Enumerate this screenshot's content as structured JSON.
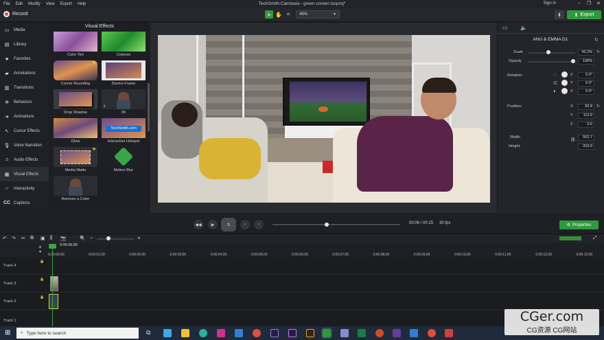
{
  "menu": [
    "File",
    "Edit",
    "Modify",
    "View",
    "Export",
    "Help"
  ],
  "app_title": "TechSmith Camtasia - green screen.tscproj*",
  "signin": "Sign in",
  "record_label": "Record",
  "zoom": "48%",
  "export_label": "Export",
  "sidebar": [
    "Media",
    "Library",
    "Favorites",
    "Annotations",
    "Transitions",
    "Behaviors",
    "Animations",
    "Cursor Effects",
    "Voice Narration",
    "Audio Effects",
    "Visual Effects",
    "Interactivity",
    "Captions"
  ],
  "effects_title": "Visual Effects",
  "effects": [
    "Color Tint",
    "Colorize",
    "Corner Rounding",
    "Device Frame",
    "Drop Shadow",
    "00",
    "Glow",
    "Interactive Hotspot",
    "Media Matte",
    "Motion Blur",
    "Remove a Color"
  ],
  "hotspot_text": "TechSmith.com",
  "props": {
    "clip_name": "ANU & EMMA D1",
    "scale_label": "Scale",
    "scale": "43.2%",
    "scale_fraction": 0.43,
    "opacity_label": "Opacity",
    "opacity": "100%",
    "opacity_fraction": 1.0,
    "rotation_label": "Rotation:",
    "rz": "0.0°",
    "ry": "0.0°",
    "rx": "0.0°",
    "position_label": "Position:",
    "px": "92.8",
    "py": "112.9",
    "pz": "0.0",
    "width_label": "Width:",
    "width": "552.7",
    "height_label": "Height:",
    "height": "310.9",
    "z": "Z",
    "y": "Y",
    "x": "X",
    "properties_btn": "Properties"
  },
  "timecode": "00:06 / 00:15",
  "fps": "30 fps",
  "playhead_time": "0:00:06;09",
  "ruler": [
    "0:00:00;00",
    "0:00:01;00",
    "0:00:02;00",
    "0:00:03;00",
    "0:00:04;00",
    "0:00:05;00",
    "0:00:06;00",
    "0:00:07;00",
    "0:00:08;00",
    "0:00:09;00",
    "0:00:10;00",
    "0:00:11;00",
    "0:00:12;00",
    "0:00:13;00"
  ],
  "tracks": [
    "Track 4",
    "Track 3",
    "Track 2",
    "Track 1"
  ],
  "taskbar_search": "Type here to search",
  "watermark_main": "CGer.com",
  "watermark_sub": "CG资源 CG网站"
}
